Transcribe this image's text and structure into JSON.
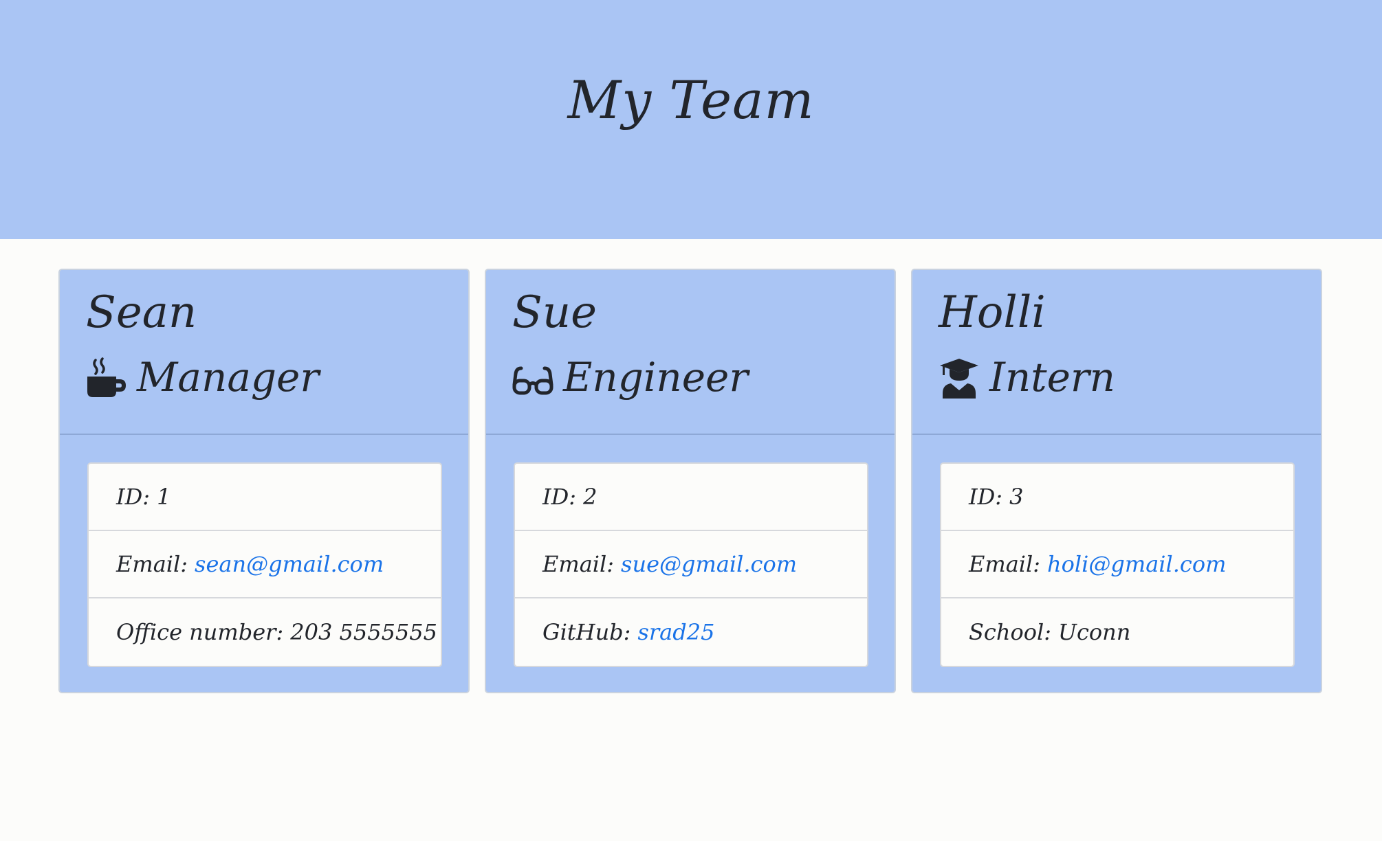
{
  "header": {
    "title": "My Team"
  },
  "colors": {
    "accent": "#aac5f4",
    "link": "#1a73e8",
    "text": "#22252b"
  },
  "employees": [
    {
      "name": "Sean",
      "role": "Manager",
      "icon": "coffee-mug-icon",
      "id_label": "ID:",
      "id": "1",
      "email_label": "Email:",
      "email": "sean@gmail.com",
      "extra_label": "Office number:",
      "extra": "203 5555555"
    },
    {
      "name": "Sue",
      "role": "Engineer",
      "icon": "glasses-icon",
      "id_label": "ID:",
      "id": "2",
      "email_label": "Email:",
      "email": "sue@gmail.com",
      "extra_label": "GitHub:",
      "extra": "srad25"
    },
    {
      "name": "Holli",
      "role": "Intern",
      "icon": "graduate-icon",
      "id_label": "ID:",
      "id": "3",
      "email_label": "Email:",
      "email": "holi@gmail.com",
      "extra_label": "School:",
      "extra": "Uconn"
    }
  ]
}
